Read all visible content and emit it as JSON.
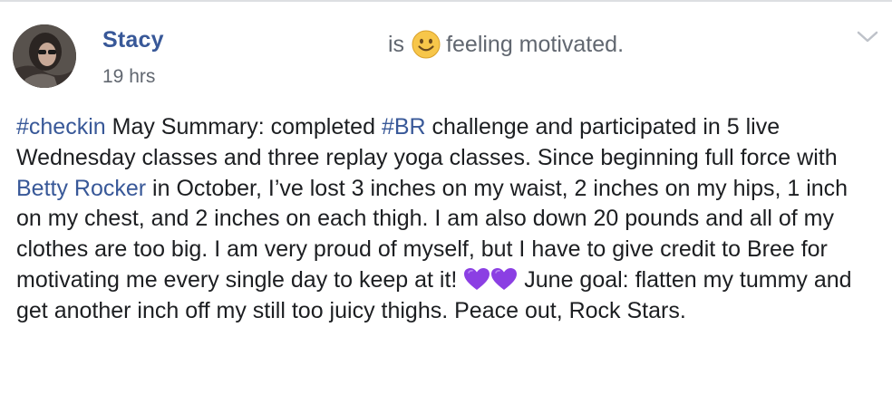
{
  "post": {
    "author": "Stacy",
    "timestamp": "19 hrs",
    "feeling": {
      "prefix": "is",
      "emoji_icon": "slightly-smiling-face-icon",
      "text": "feeling motivated."
    },
    "menu_icon": "chevron-down-icon",
    "body": {
      "p1": "#checkin",
      "p2": " May Summary: completed ",
      "p3": "#BR",
      "p4": " challenge and participated in 5 live Wednesday classes and three replay yoga classes. Since beginning full force with ",
      "p5": "Betty Rocker",
      "p6": " in October, I’ve lost 3 inches on my waist, 2 inches on my hips, 1 inch on my chest, and 2 inches on each thigh. I am also down 20 pounds and all of my clothes are too big. I am very proud of myself, but I have to give credit to Bree for motivating me every single day to keep at it! ",
      "heart_icon": "purple-heart-icon",
      "p7": " June goal: flatten my tummy and get another inch off my still too juicy thighs. Peace out, Rock Stars."
    }
  },
  "colors": {
    "link": "#385898",
    "meta": "#616770",
    "text": "#1c1e21",
    "heart": "#8b3fe3",
    "emoji": "#f7c64a"
  }
}
